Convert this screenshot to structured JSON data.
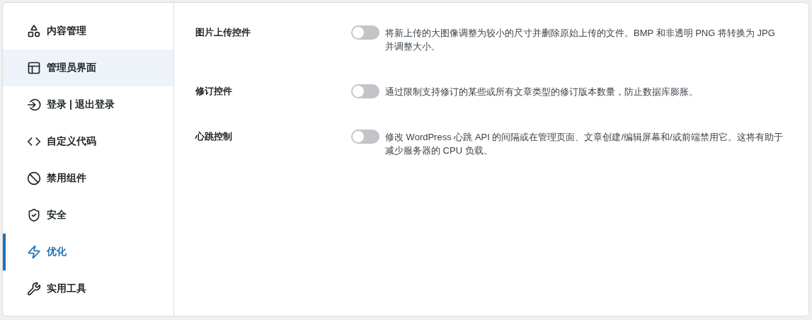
{
  "sidebar": {
    "items": [
      {
        "label": "内容管理",
        "selected": false,
        "hovered": false
      },
      {
        "label": "管理员界面",
        "selected": false,
        "hovered": true
      },
      {
        "label": "登录 | 退出登录",
        "selected": false,
        "hovered": false
      },
      {
        "label": "自定义代码",
        "selected": false,
        "hovered": false
      },
      {
        "label": "禁用组件",
        "selected": false,
        "hovered": false
      },
      {
        "label": "安全",
        "selected": false,
        "hovered": false
      },
      {
        "label": "优化",
        "selected": true,
        "hovered": false
      },
      {
        "label": "实用工具",
        "selected": false,
        "hovered": false
      }
    ]
  },
  "settings": [
    {
      "label": "图片上传控件",
      "on": false,
      "description": "将新上传的大图像调整为较小的尺寸并删除原始上传的文件。BMP 和非透明 PNG 将转换为 JPG 并调整大小。"
    },
    {
      "label": "修订控件",
      "on": false,
      "description": "通过限制支持修订的某些或所有文章类型的修订版本数量，防止数据库膨胀。"
    },
    {
      "label": "心跳控制",
      "on": false,
      "description": "修改 WordPress 心跳 API 的间隔或在管理页面、文章创建/编辑屏幕和/或前端禁用它。这将有助于减少服务器的 CPU 负载。"
    }
  ]
}
